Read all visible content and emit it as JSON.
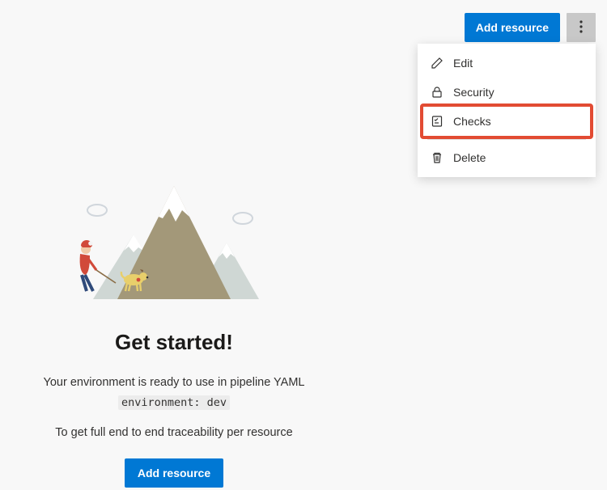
{
  "colors": {
    "primary": "#0078d4",
    "highlight_border": "#e24b33"
  },
  "toolbar": {
    "add_resource_label": "Add resource"
  },
  "menu": {
    "items": [
      {
        "label": "Edit",
        "icon": "pencil-icon"
      },
      {
        "label": "Security",
        "icon": "lock-icon"
      },
      {
        "label": "Checks",
        "icon": "checklist-icon",
        "highlighted": true
      }
    ],
    "footer_items": [
      {
        "label": "Delete",
        "icon": "trash-icon"
      }
    ]
  },
  "empty_state": {
    "title": "Get started!",
    "line1": "Your environment is ready to use in pipeline YAML",
    "code": "environment: dev",
    "line2": "To get full end to end traceability per resource",
    "button_label": "Add resource"
  }
}
